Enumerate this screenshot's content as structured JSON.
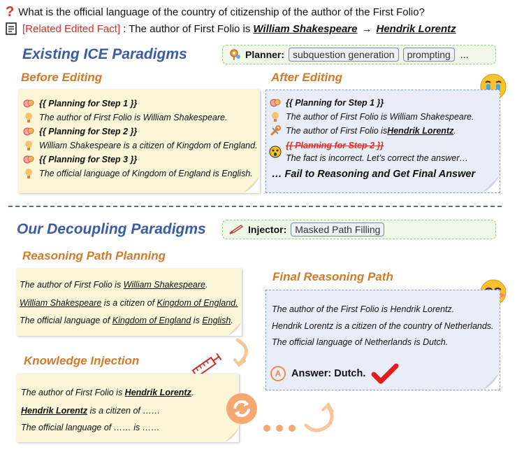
{
  "question": "What is the official language of the country of citizenship of the author of the First Folio?",
  "fact": {
    "tag": "[Related Edited Fact]",
    "prefix": ": The author of First Folio is ",
    "old": "William Shakespeare",
    "arrow": "→",
    "new": "Hendrik Lorentz"
  },
  "existing": {
    "title": "Existing ICE Paradigms",
    "planner_label": "Planner:",
    "chips": [
      "subquestion generation",
      "prompting"
    ],
    "ellipsis": "...",
    "before_title": "Before Editing",
    "before_lines": [
      "{{ Planning for Step 1 }}",
      "The author of First Folio is William Shakespeare.",
      "{{ Planning for Step 2 }}",
      "William Shakespeare is a citizen of Kingdom of England.",
      "{{ Planning for Step 3 }}",
      "The official language of Kingdom of England is English."
    ],
    "after_title": "After Editing",
    "after": {
      "l1": "{{ Planning for Step 1 }}",
      "l2": "The author of First Folio is William Shakespeare.",
      "l3_pre": "The author of First Folio is ",
      "l3_name": "Hendrik Lorentz",
      "l3_post": ".",
      "l4": "{{ Planning for Step 2 }}",
      "l5": "The fact is incorrect. Let’s correct the answer…",
      "fail": "… Fail to Reasoning and Get Final Answer"
    }
  },
  "ours": {
    "title": "Our Decoupling Paradigms",
    "injector_label": "Injector:",
    "chip": "Masked Path Filling",
    "rpp_title": "Reasoning Path Planning",
    "rpp": {
      "l1_pre": "The author of First Folio is ",
      "l1_name": "William Shakespeare",
      "l1_post": ".",
      "l2_name": "William Shakespeare",
      "l2_mid": " is a citizen of ",
      "l2_place": "Kingdom of England.",
      "l3_pre": "The official language of ",
      "l3_place": "Kingdom of England",
      "l3_mid": " is ",
      "l3_lang": "English",
      "l3_post": "."
    },
    "ki_title": "Knowledge Injection",
    "ki": {
      "l1_pre": "The author of First Folio is ",
      "l1_name": "Hendrik Lorentz",
      "l1_post": ".",
      "l2_name": "Hendrik Lorentz",
      "l2_post": " is a citizen of ……",
      "l3": "The official language of …… is ……"
    },
    "final_title": "Final Reasoning Path",
    "final_lines": [
      "The author of the First Folio is Hendrik Lorentz.",
      "Hendrik Lorentz is a citizen of the country of Netherlands.",
      "The official language of Netherlands is Dutch."
    ],
    "answer_badge": "A",
    "answer": "Answer: Dutch."
  },
  "colors": {
    "blue_heading": "#3a5ba6",
    "orange_heading": "#d07a2a",
    "red_accent": "#d9322b",
    "yellow_note": "#fbf6d8",
    "blue_note": "#e9edf7",
    "green_box": "#eef7e8"
  },
  "icons": [
    "question-mark-icon",
    "document-icon",
    "map-pin-icon",
    "brain-icon",
    "lightbulb-icon",
    "wrench-icon",
    "shocked-face-icon",
    "crying-face-icon",
    "pen-icon",
    "syringe-icon",
    "refresh-icon",
    "smile-face-icon",
    "check-icon",
    "curved-arrow-icon"
  ]
}
